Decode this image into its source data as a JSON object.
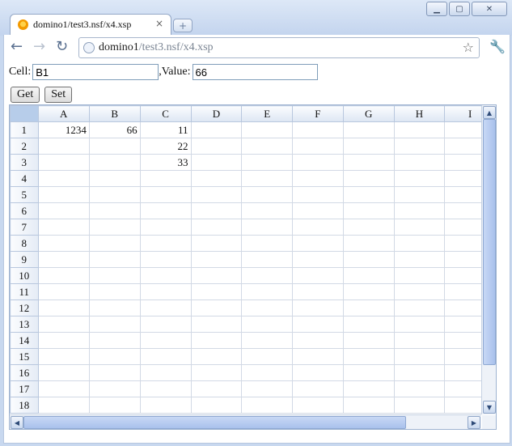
{
  "window": {
    "controls": {
      "minimize": "▁",
      "maximize": "▢",
      "close": "✕"
    }
  },
  "tab": {
    "title": "domino1/test3.nsf/x4.xsp",
    "close": "×",
    "new_tab": "+"
  },
  "toolbar": {
    "back": "←",
    "forward": "→",
    "reload": "↻",
    "url_host": "domino1",
    "url_path": "/test3.nsf/x4.xsp",
    "star": "☆",
    "wrench": "🔧"
  },
  "form": {
    "cell_label": "Cell:",
    "cell_value": "B1",
    "value_label": ",Value:",
    "value_value": "66",
    "get_label": "Get",
    "set_label": "Set"
  },
  "grid": {
    "columns": [
      "A",
      "B",
      "C",
      "D",
      "E",
      "F",
      "G",
      "H",
      "I"
    ],
    "rows": [
      {
        "label": "1",
        "cells": [
          "1234",
          "66",
          "11",
          "",
          "",
          "",
          "",
          "",
          ""
        ]
      },
      {
        "label": "2",
        "cells": [
          "",
          "",
          "22",
          "",
          "",
          "",
          "",
          "",
          ""
        ]
      },
      {
        "label": "3",
        "cells": [
          "",
          "",
          "33",
          "",
          "",
          "",
          "",
          "",
          ""
        ]
      },
      {
        "label": "4",
        "cells": [
          "",
          "",
          "",
          "",
          "",
          "",
          "",
          "",
          ""
        ]
      },
      {
        "label": "5",
        "cells": [
          "",
          "",
          "",
          "",
          "",
          "",
          "",
          "",
          ""
        ]
      },
      {
        "label": "6",
        "cells": [
          "",
          "",
          "",
          "",
          "",
          "",
          "",
          "",
          ""
        ]
      },
      {
        "label": "7",
        "cells": [
          "",
          "",
          "",
          "",
          "",
          "",
          "",
          "",
          ""
        ]
      },
      {
        "label": "8",
        "cells": [
          "",
          "",
          "",
          "",
          "",
          "",
          "",
          "",
          ""
        ]
      },
      {
        "label": "9",
        "cells": [
          "",
          "",
          "",
          "",
          "",
          "",
          "",
          "",
          ""
        ]
      },
      {
        "label": "10",
        "cells": [
          "",
          "",
          "",
          "",
          "",
          "",
          "",
          "",
          ""
        ]
      },
      {
        "label": "11",
        "cells": [
          "",
          "",
          "",
          "",
          "",
          "",
          "",
          "",
          ""
        ]
      },
      {
        "label": "12",
        "cells": [
          "",
          "",
          "",
          "",
          "",
          "",
          "",
          "",
          ""
        ]
      },
      {
        "label": "13",
        "cells": [
          "",
          "",
          "",
          "",
          "",
          "",
          "",
          "",
          ""
        ]
      },
      {
        "label": "14",
        "cells": [
          "",
          "",
          "",
          "",
          "",
          "",
          "",
          "",
          ""
        ]
      },
      {
        "label": "15",
        "cells": [
          "",
          "",
          "",
          "",
          "",
          "",
          "",
          "",
          ""
        ]
      },
      {
        "label": "16",
        "cells": [
          "",
          "",
          "",
          "",
          "",
          "",
          "",
          "",
          ""
        ]
      },
      {
        "label": "17",
        "cells": [
          "",
          "",
          "",
          "",
          "",
          "",
          "",
          "",
          ""
        ]
      },
      {
        "label": "18",
        "cells": [
          "",
          "",
          "",
          "",
          "",
          "",
          "",
          "",
          ""
        ]
      }
    ]
  },
  "scroll": {
    "up": "▲",
    "down": "▼",
    "left": "◀",
    "right": "▶"
  }
}
